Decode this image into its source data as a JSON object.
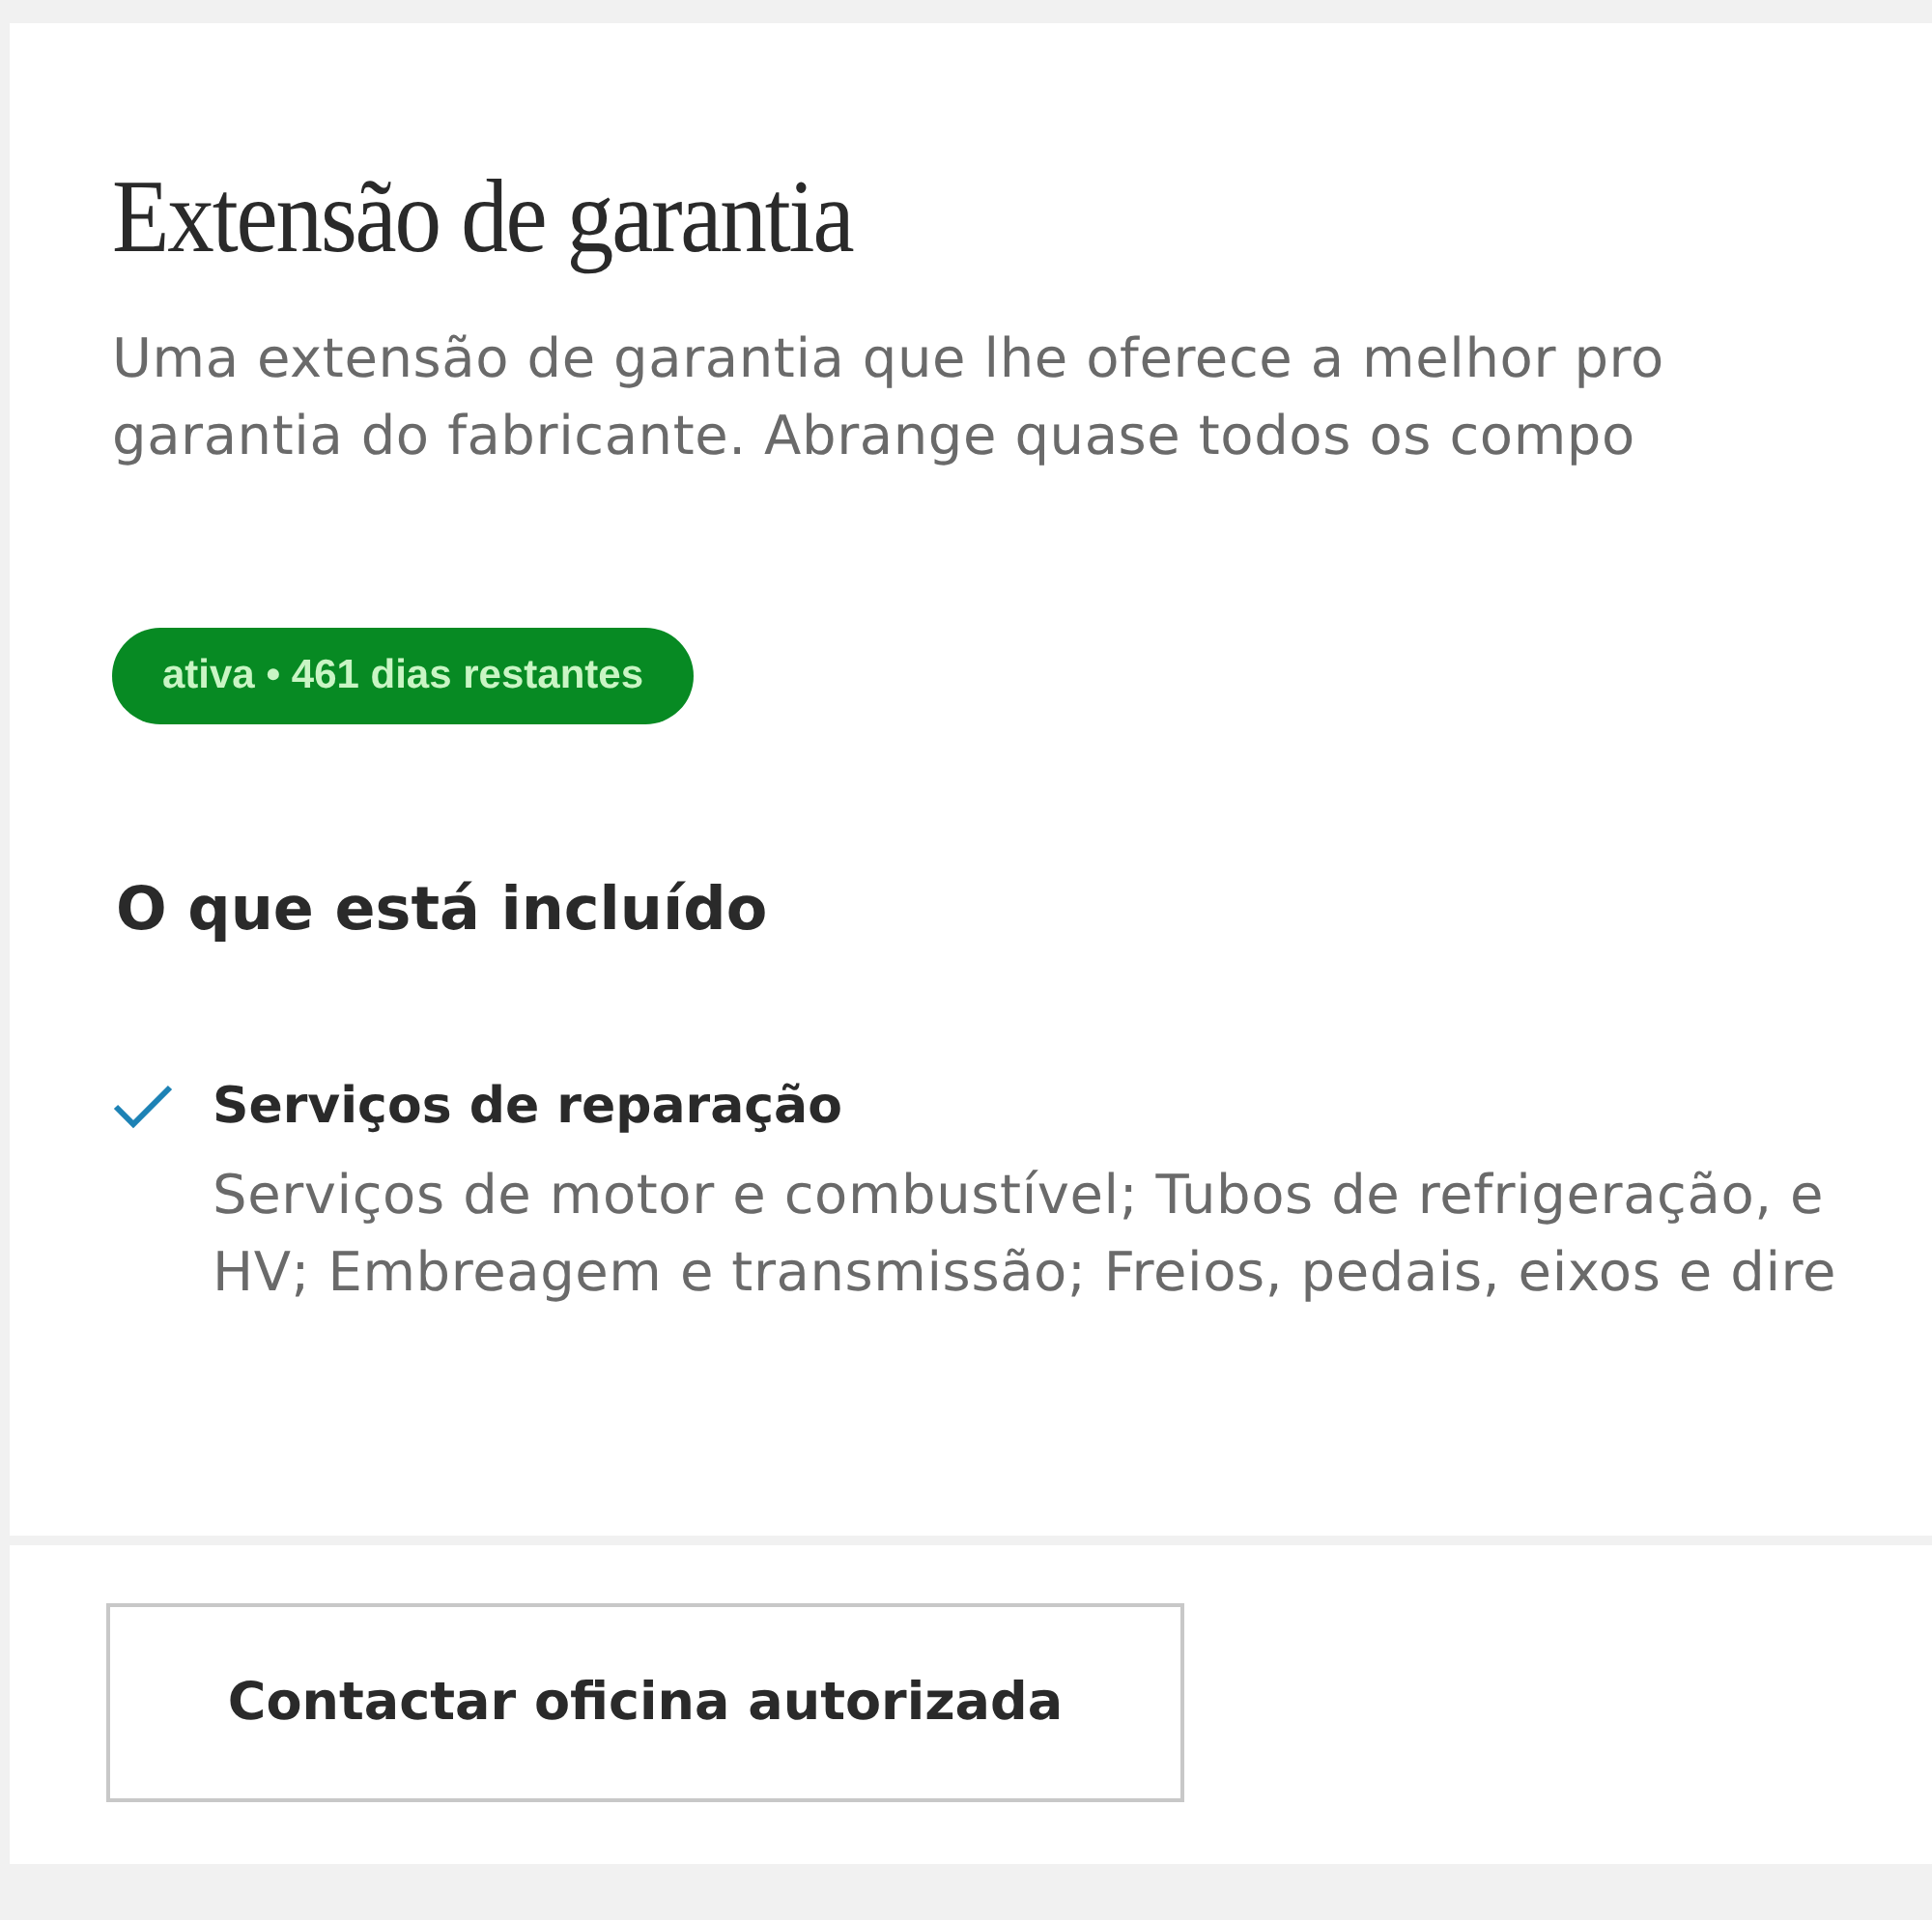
{
  "title": "Extensão de garantia",
  "description_lines": [
    "Uma extensão de garantia que lhe oferece a melhor pro",
    "garantia do fabricante. Abrange quase todos os compo"
  ],
  "status_badge": {
    "text": "ativa • 461 dias restantes",
    "active": true
  },
  "included_heading": "O que está incluído",
  "included_items": [
    {
      "title": "Serviços de reparação",
      "included": true,
      "lines": [
        "Serviços de motor e combustível; Tubos de refrigeração, e",
        "HV; Embreagem e transmissão; Freios, pedais, eixos e dire"
      ]
    }
  ],
  "buttons": [
    "Contactar oficina autorizada"
  ]
}
